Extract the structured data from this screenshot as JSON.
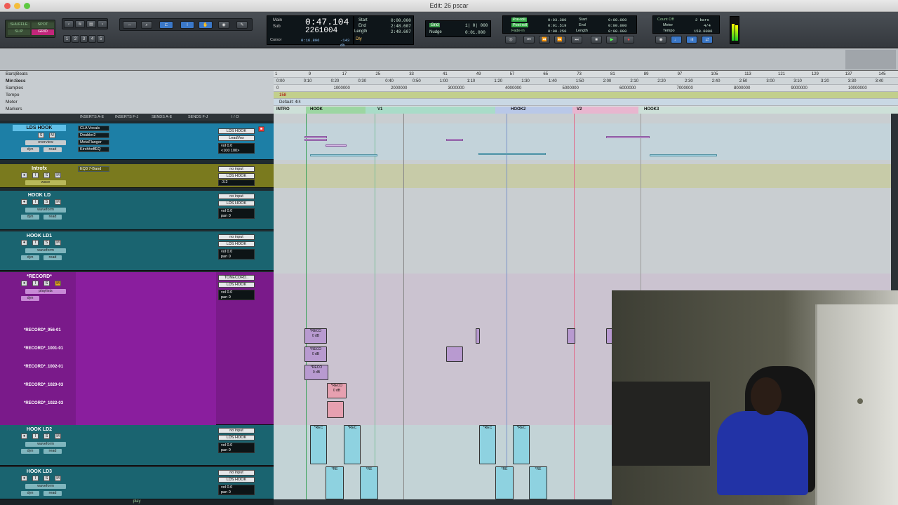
{
  "window": {
    "title": "Edit: 26 pscar"
  },
  "toolbar": {
    "edit_modes": [
      "SHUFFLE",
      "SPOT",
      "SLIP",
      "GRID"
    ],
    "zoom_presets": [
      "1",
      "2",
      "3",
      "4",
      "5"
    ],
    "counter": {
      "main_label": "Main",
      "sub_label": "Sub",
      "main_value": "0:47.104",
      "sub_value": "2261004",
      "cursor_label": "Cursor",
      "cursor_value": "0:16.896",
      "db_value": "-143 db",
      "dly_label": "Dly"
    },
    "selection": {
      "start_label": "Start",
      "end_label": "End",
      "length_label": "Length",
      "start": "0:00.000",
      "end": "2:48.607",
      "length": "2:48.607"
    },
    "grid": {
      "grid_label": "Grid",
      "grid_value": "1| 0| 000",
      "nudge_label": "Nudge",
      "nudge_value": "0:01.000"
    },
    "preroll": {
      "pre_label": "Pre-roll",
      "post_label": "Post-roll",
      "fade_label": "Fade-in",
      "pre": "0:03.380",
      "post": "0:01.519",
      "fade": "0:00.250"
    },
    "transport_sel": {
      "start": "0:00.000",
      "end": "0:00.000",
      "length": "0:00.000"
    },
    "count": {
      "count_off": "Count Off",
      "meter_label": "Meter",
      "tempo_label": "Tempo",
      "bars": "2 bars",
      "meter": "4/4",
      "tempo": "158.0000"
    }
  },
  "rulers": {
    "labels": [
      "Bars|Beats",
      "Min:Secs",
      "Samples",
      "Tempo",
      "Meter",
      "Markers"
    ],
    "bars": [
      "1",
      "9",
      "17",
      "25",
      "33",
      "41",
      "49",
      "57",
      "65",
      "73",
      "81",
      "89",
      "97",
      "105",
      "113",
      "121",
      "129",
      "137",
      "145"
    ],
    "minsecs": [
      "0:00",
      "0:10",
      "0:20",
      "0:30",
      "0:40",
      "0:50",
      "1:00",
      "1:10",
      "1:20",
      "1:30",
      "1:40",
      "1:50",
      "2:00",
      "2:10",
      "2:20",
      "2:30",
      "2:40",
      "2:50",
      "3:00",
      "3:10",
      "3:20",
      "3:30",
      "3:40"
    ],
    "samples": [
      "0",
      "1000000",
      "2000000",
      "3000000",
      "4000000",
      "5000000",
      "6000000",
      "7000000",
      "8000000",
      "9000000",
      "10000000"
    ],
    "tempo": "158",
    "meter": "Default: 4/4",
    "markers": [
      "INTRO",
      "HOOK",
      "V1",
      "HOOK2",
      "V2",
      "HOOK3"
    ]
  },
  "columns": {
    "inserts_ae": "INSERTS A-E",
    "inserts_fj": "INSERTS F-J",
    "sends_ae": "SENDS A-E",
    "sends_fj": "SENDS F-J",
    "io": "I / O"
  },
  "tracks": [
    {
      "name": "LDS HOOK",
      "view": "overview",
      "mode": "dyn",
      "auto": "read",
      "inserts": [
        "CLA Vocals",
        "Doubler2",
        "MetaFlanger",
        "KirchhoffEQ"
      ],
      "input": "LDS HOOK",
      "output": "LeadVox",
      "vol": "vol 0.0",
      "pan": "<100 100>"
    },
    {
      "name": "Introfx",
      "view": "wave",
      "mode": "",
      "auto": "",
      "inserts": [
        "EQ3 7-Band"
      ],
      "input": "no input",
      "output": "LDS HOOK",
      "vol": "vol 0.0",
      "pan": "-3.2"
    },
    {
      "name": "HOOK LD",
      "view": "waveform",
      "mode": "dyn",
      "auto": "read",
      "inserts": [],
      "input": "no input",
      "output": "LDS HOOK",
      "vol": "vol 0.0",
      "pan": "pan 0"
    },
    {
      "name": "HOOK LD1",
      "view": "waveform",
      "mode": "dyn",
      "auto": "read",
      "inserts": [],
      "input": "no input",
      "output": "LDS HOOK",
      "vol": "vol 0.0",
      "pan": "pan 0"
    },
    {
      "name": "*RECORD*",
      "view": "playlists",
      "mode": "dyn",
      "auto": "",
      "inserts": [],
      "input": "TONECORD..",
      "output": "LDS HOOK",
      "vol": "vol 0.0",
      "pan": "pan 0"
    },
    {
      "name": "HOOK LD2",
      "view": "waveform",
      "mode": "dyn",
      "auto": "read",
      "inserts": [],
      "input": "no input",
      "output": "LDS HOOK",
      "vol": "vol 0.0",
      "pan": "pan 0"
    },
    {
      "name": "HOOK LD3",
      "view": "waveform",
      "mode": "dyn",
      "auto": "read",
      "inserts": [],
      "input": "no input",
      "output": "LDS HOOK",
      "vol": "vol 0.0",
      "pan": "pan 0"
    }
  ],
  "playlists": [
    "*RECORD*_956-01",
    "*RECORD*_1001-01",
    "*RECORD*_1002-01",
    "*RECORD*_1020-03",
    "*RECORD*_1022-03"
  ],
  "clips": {
    "record": "*RECO",
    "gain": "0 dB",
    "rec_short": "*REC",
    "re_short": "*RE"
  },
  "status": {
    "play": "play"
  },
  "colors": {
    "lds": "#2aa3c9",
    "introfx": "#8a8a1c",
    "record": "#7a1a8a",
    "hook": "#1f6f7a",
    "clip_purple": "#b89ad0",
    "clip_cyan": "#8ed2e0",
    "clip_pink": "#e6a0b0"
  }
}
